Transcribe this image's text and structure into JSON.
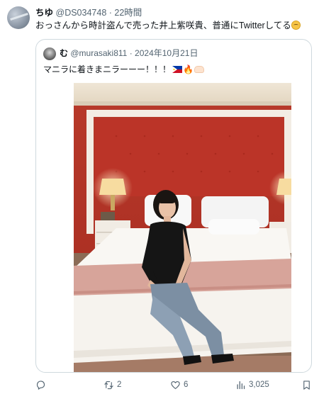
{
  "post": {
    "name": "ちゆ",
    "handle": "@DS034748",
    "separator": "·",
    "time": "22時間",
    "text": "おっさんから時計盗んで売った井上紫咲貴、普通にTwitterしてる"
  },
  "quoted": {
    "name": "む",
    "handle": "@murasaki811",
    "separator": "·",
    "date": "2024年10月21日",
    "text": "マニラに着きまニラーーー！！！"
  },
  "actions": {
    "reply_count": "",
    "retweet_count": "2",
    "like_count": "6",
    "views_count": "3,025"
  },
  "icons": [
    "reply-icon",
    "retweet-icon",
    "like-icon",
    "views-icon",
    "bookmark-icon",
    "philippines-flag-icon",
    "fire-icon",
    "hands-icon",
    "pleading-face-icon"
  ]
}
